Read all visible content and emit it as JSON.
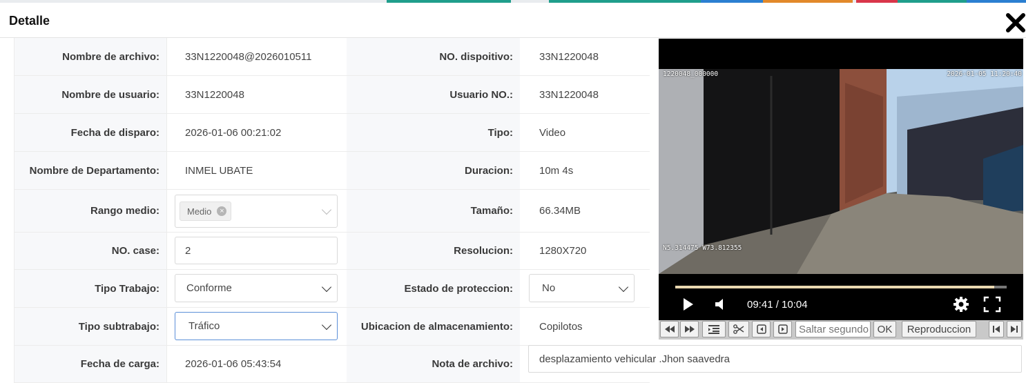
{
  "modal": {
    "title": "Detalle"
  },
  "fields": {
    "nombre_archivo": {
      "label": "Nombre de archivo:",
      "value": "33N1220048@2026010511"
    },
    "nombre_usuario": {
      "label": "Nombre de usuario:",
      "value": "33N1220048"
    },
    "fecha_disparo": {
      "label": "Fecha de disparo:",
      "value": "2026-01-06 00:21:02"
    },
    "departamento": {
      "label": "Nombre de Departamento:",
      "value": "INMEL UBATE"
    },
    "rango_medio": {
      "label": "Rango medio:",
      "tag": "Medio"
    },
    "no_case": {
      "label": "NO. case:",
      "value": "2"
    },
    "tipo_trabajo": {
      "label": "Tipo Trabajo:",
      "value": "Conforme"
    },
    "tipo_subtrabajo": {
      "label": "Tipo subtrabajo:",
      "value": "Tráfico"
    },
    "fecha_carga": {
      "label": "Fecha de carga:",
      "value": "2026-01-06 05:43:54"
    },
    "no_dispositivo": {
      "label": "NO. dispoitivo:",
      "value": "33N1220048"
    },
    "usuario_no": {
      "label": "Usuario NO.:",
      "value": "33N1220048"
    },
    "tipo": {
      "label": "Tipo:",
      "value": "Video"
    },
    "duracion": {
      "label": "Duracion:",
      "value": "10m 4s"
    },
    "tamano": {
      "label": "Tamaño:",
      "value": "66.34MB"
    },
    "resolucion": {
      "label": "Resolucion:",
      "value": "1280X720"
    },
    "estado_proteccion": {
      "label": "Estado de proteccion:",
      "value": "No"
    },
    "ubicacion": {
      "label": "Ubicacion de almacenamiento:",
      "value": "Copilotos"
    },
    "nota": {
      "label": "Nota de archivo:",
      "value": "desplazamiento vehicular .Jhon saavedra"
    }
  },
  "player": {
    "osd_device": "1220048_000000",
    "osd_datetime": "2026-01-05 11:20:40",
    "osd_gps": "N5.314475 W73.812355",
    "time": "09:41 / 10:04",
    "progress": 0.962
  },
  "toolbar": {
    "seek_placeholder": "Saltar segundo",
    "ok": "OK",
    "playback": "Reproduccion"
  }
}
